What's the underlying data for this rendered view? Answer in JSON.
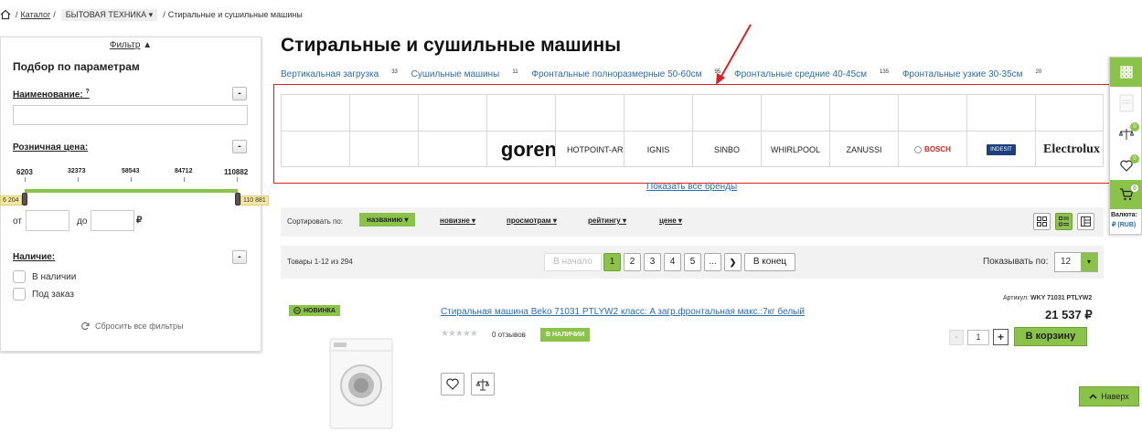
{
  "breadcrumb": {
    "items": [
      "Каталог",
      "БЫТОВАЯ ТЕХНИКА",
      "Стиральные и сушильные машины"
    ],
    "separator": "/",
    "dropdown_caret": "▾"
  },
  "filter": {
    "toggle_label": "Фильтр",
    "toggle_caret": "▲",
    "heading": "Подбор по параметрам",
    "name_label": "Наименование:",
    "name_hint": "?",
    "collapse_symbol": "-",
    "price_label": "Розничная цена:",
    "price_ticks": [
      "6203",
      "32373",
      "58543",
      "84712",
      "110882"
    ],
    "price_min_bubble": "6 204",
    "price_max_bubble": "110 881",
    "price_from_label": "от",
    "price_to_label": "до",
    "currency_sign": "₽",
    "availability_label": "Наличие:",
    "availability_options": [
      "В наличии",
      "Под заказ"
    ],
    "reset_label": "Сбросить все фильтры"
  },
  "main": {
    "title": "Стиральные и сушильные машины",
    "subcategories": [
      {
        "label": "Вертикальная загрузка",
        "count": "33"
      },
      {
        "label": "Сушильные машины",
        "count": "11"
      },
      {
        "label": "Фронтальные полноразмерные 50-60см",
        "count": "95"
      },
      {
        "label": "Фронтальные средние 40-45см",
        "count": "135"
      },
      {
        "label": "Фронтальные узкие 30-35см",
        "count": "20"
      }
    ],
    "brands_row2": [
      "",
      "",
      "",
      "goren",
      "HOTPOINT-ARISTON",
      "IGNIS",
      "SINBO",
      "WHIRLPOOL",
      "ZANUSSI",
      "BOSCH",
      "INDESIT",
      "Electrolux"
    ],
    "show_all_brands": "Показать все бренды"
  },
  "sort": {
    "label": "Сортировать по:",
    "caret": "▾",
    "options": [
      "названию",
      "новизне",
      "просмотрам",
      "рейтингу",
      "цене"
    ],
    "active_index": 0
  },
  "pager": {
    "items_count": "Товары 1-12 из 294",
    "first_label": "В начало",
    "pages": [
      "1",
      "2",
      "3",
      "4",
      "5",
      "..."
    ],
    "current_page": "1",
    "next_symbol": "❯",
    "last_label": "В конец",
    "per_page_label": "Показывать по:",
    "per_page_value": "12",
    "per_page_caret": "▾"
  },
  "product": {
    "badge": "НОВИНКА",
    "title": "Стиральная машина Beko 71031 PTLYW2 класс: A загр.фронтальная макс.:7кг белый",
    "stars": "★★★★★",
    "reviews": "0 отзывов",
    "stock": "В НАЛИЧИИ",
    "sku_label": "Артикул:",
    "sku_value": "WKY 71031 PTLYW2",
    "price": "21 537 ₽",
    "qty_minus": "-",
    "qty": "1",
    "qty_plus": "+",
    "cart_button": "В корзину"
  },
  "back_to_top": "Наверх",
  "sidebar": {
    "compare_count": "0",
    "favorites_count": "0",
    "cart_count": "0",
    "currency_label": "Валюта:",
    "currency_value": "₽ (RUB)"
  },
  "colors": {
    "accent_green": "#8bc34a",
    "link_blue": "#2a6db5",
    "highlight_red": "#e02020"
  }
}
